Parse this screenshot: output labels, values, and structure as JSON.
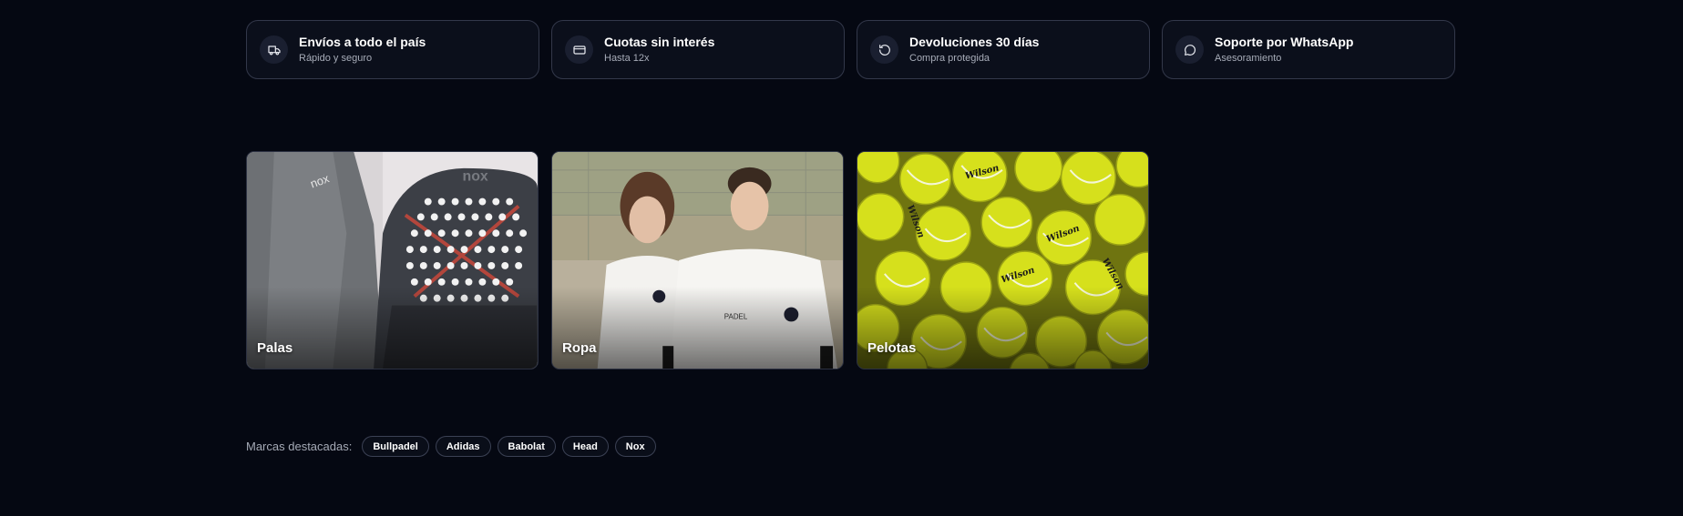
{
  "benefits": [
    {
      "title": "Envíos a todo el país",
      "subtitle": "Rápido y seguro",
      "icon": "truck-icon"
    },
    {
      "title": "Cuotas sin interés",
      "subtitle": "Hasta 12x",
      "icon": "credit-card-icon"
    },
    {
      "title": "Devoluciones 30 días",
      "subtitle": "Compra protegida",
      "icon": "rotate-ccw-icon"
    },
    {
      "title": "Soporte por WhatsApp",
      "subtitle": "Asesoramiento",
      "icon": "chat-bubble-icon"
    }
  ],
  "categories": [
    {
      "label": "Palas",
      "image": "padel-racket-photo"
    },
    {
      "label": "Ropa",
      "image": "padel-apparel-photo"
    },
    {
      "label": "Pelotas",
      "image": "tennis-balls-photo"
    }
  ],
  "brands": {
    "label": "Marcas destacadas:",
    "items": [
      "Bullpadel",
      "Adidas",
      "Babolat",
      "Head",
      "Nox"
    ]
  },
  "colors": {
    "background": "#050812",
    "card": "#0b0f1b",
    "border": "#33384a",
    "ball": "#d8e21e"
  }
}
